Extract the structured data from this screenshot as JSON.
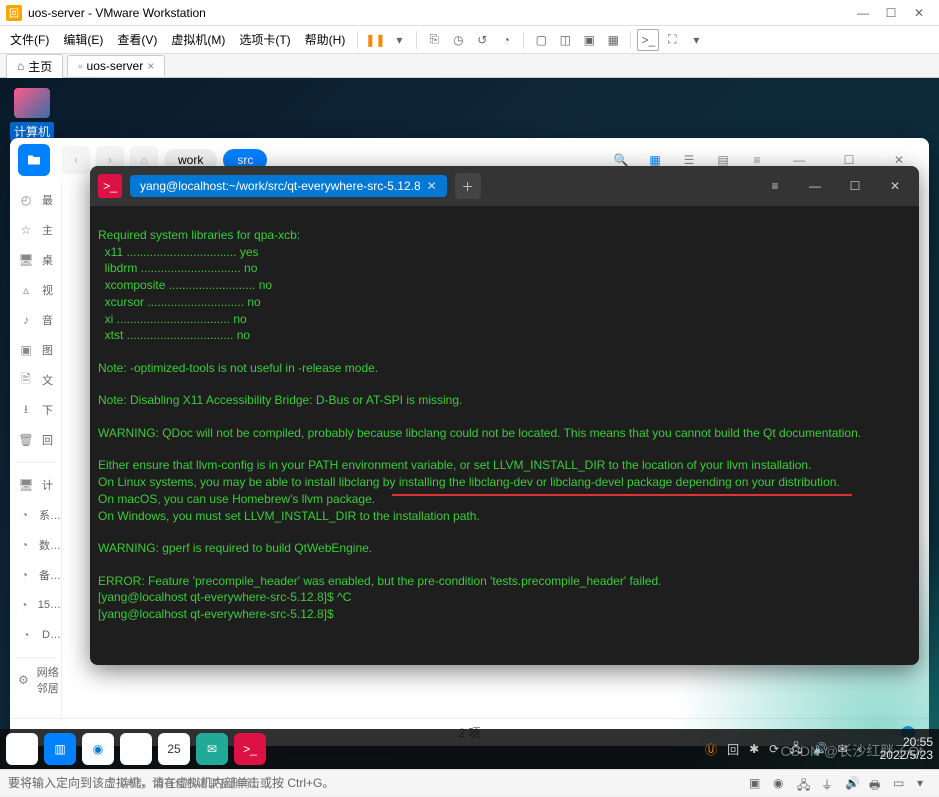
{
  "vmware": {
    "title": "uos-server - VMware Workstation",
    "menus": [
      "文件(F)",
      "编辑(E)",
      "查看(V)",
      "虚拟机(M)",
      "选项卡(T)",
      "帮助(H)"
    ],
    "tabs": {
      "home": "主页",
      "vm": "uos-server"
    }
  },
  "desktop_icon": "计算机",
  "filemanager": {
    "crumbs": {
      "home_icon": "⌂",
      "work": "work",
      "src": "src"
    },
    "sidebar": [
      {
        "ic": "◴",
        "tx": "最"
      },
      {
        "ic": "☆",
        "tx": "主"
      },
      {
        "ic": "🖥",
        "tx": "桌"
      },
      {
        "ic": "▵",
        "tx": "视"
      },
      {
        "ic": "♪",
        "tx": "音"
      },
      {
        "ic": "▣",
        "tx": "图"
      },
      {
        "ic": "🖹",
        "tx": "文"
      },
      {
        "ic": "⭳",
        "tx": "下"
      },
      {
        "ic": "🗑",
        "tx": "回"
      },
      {
        "ic": "—",
        "tx": "",
        "sep": true
      },
      {
        "ic": "🖥",
        "tx": "计"
      },
      {
        "ic": "◔",
        "tx": "系…"
      },
      {
        "ic": "◔",
        "tx": "数…"
      },
      {
        "ic": "◔",
        "tx": "备…"
      },
      {
        "ic": "◔",
        "tx": "15…"
      },
      {
        "ic": "◔",
        "tx": "D…"
      },
      {
        "ic": "—",
        "tx": "",
        "sep": true
      },
      {
        "ic": "⚙",
        "tx": "网络邻居"
      }
    ],
    "footer_items": "2 项"
  },
  "terminal": {
    "tab_title": "yang@localhost:~/work/src/qt-everywhere-src-5.12.8",
    "lines": {
      "l0": "Required system libraries for qpa-xcb:",
      "l1": "  x11 ................................. yes",
      "l2": "  libdrm .............................. no",
      "l3": "  xcomposite .......................... no",
      "l4": "  xcursor ............................. no",
      "l5": "  xi .................................. no",
      "l6": "  xtst ................................ no",
      "n1": "Note: -optimized-tools is not useful in -release mode.",
      "n2": "Note: Disabling X11 Accessibility Bridge: D-Bus or AT-SPI is missing.",
      "w1": "WARNING: QDoc will not be compiled, probably because libclang could not be located. This means that you cannot build the Qt documentation.",
      "p1": "Either ensure that llvm-config is in your PATH environment variable, or set LLVM_INSTALL_DIR to the location of your llvm installation.",
      "p2": "On Linux systems, you may be able to install libclang by installing the libclang-dev or libclang-devel package depending on your distribution.",
      "p3": "On macOS, you can use Homebrew's llvm package.",
      "p4": "On Windows, you must set LLVM_INSTALL_DIR to the installation path.",
      "w2": "WARNING: gperf is required to build QtWebEngine.",
      "e1": "ERROR: Feature 'precompile_header' was enabled, but the pre-condition 'tests.precompile_header' failed.",
      "pr1": "[yang@localhost qt-everywhere-src-5.12.8]$ ^C",
      "pr2": "[yang@localhost qt-everywhere-src-5.12.8]$ "
    }
  },
  "taskbar": {
    "cal_day": "25",
    "clock_time": "20:55",
    "clock_date": "2022/5/23"
  },
  "status_hint": "要将输入定向到该虚拟机，请在虚拟机内部单击或按 Ctrl+G。",
  "bg_hint": "存储，如有侵权请联系删除。",
  "watermark": "CSDN @长沙红胖子Qt"
}
